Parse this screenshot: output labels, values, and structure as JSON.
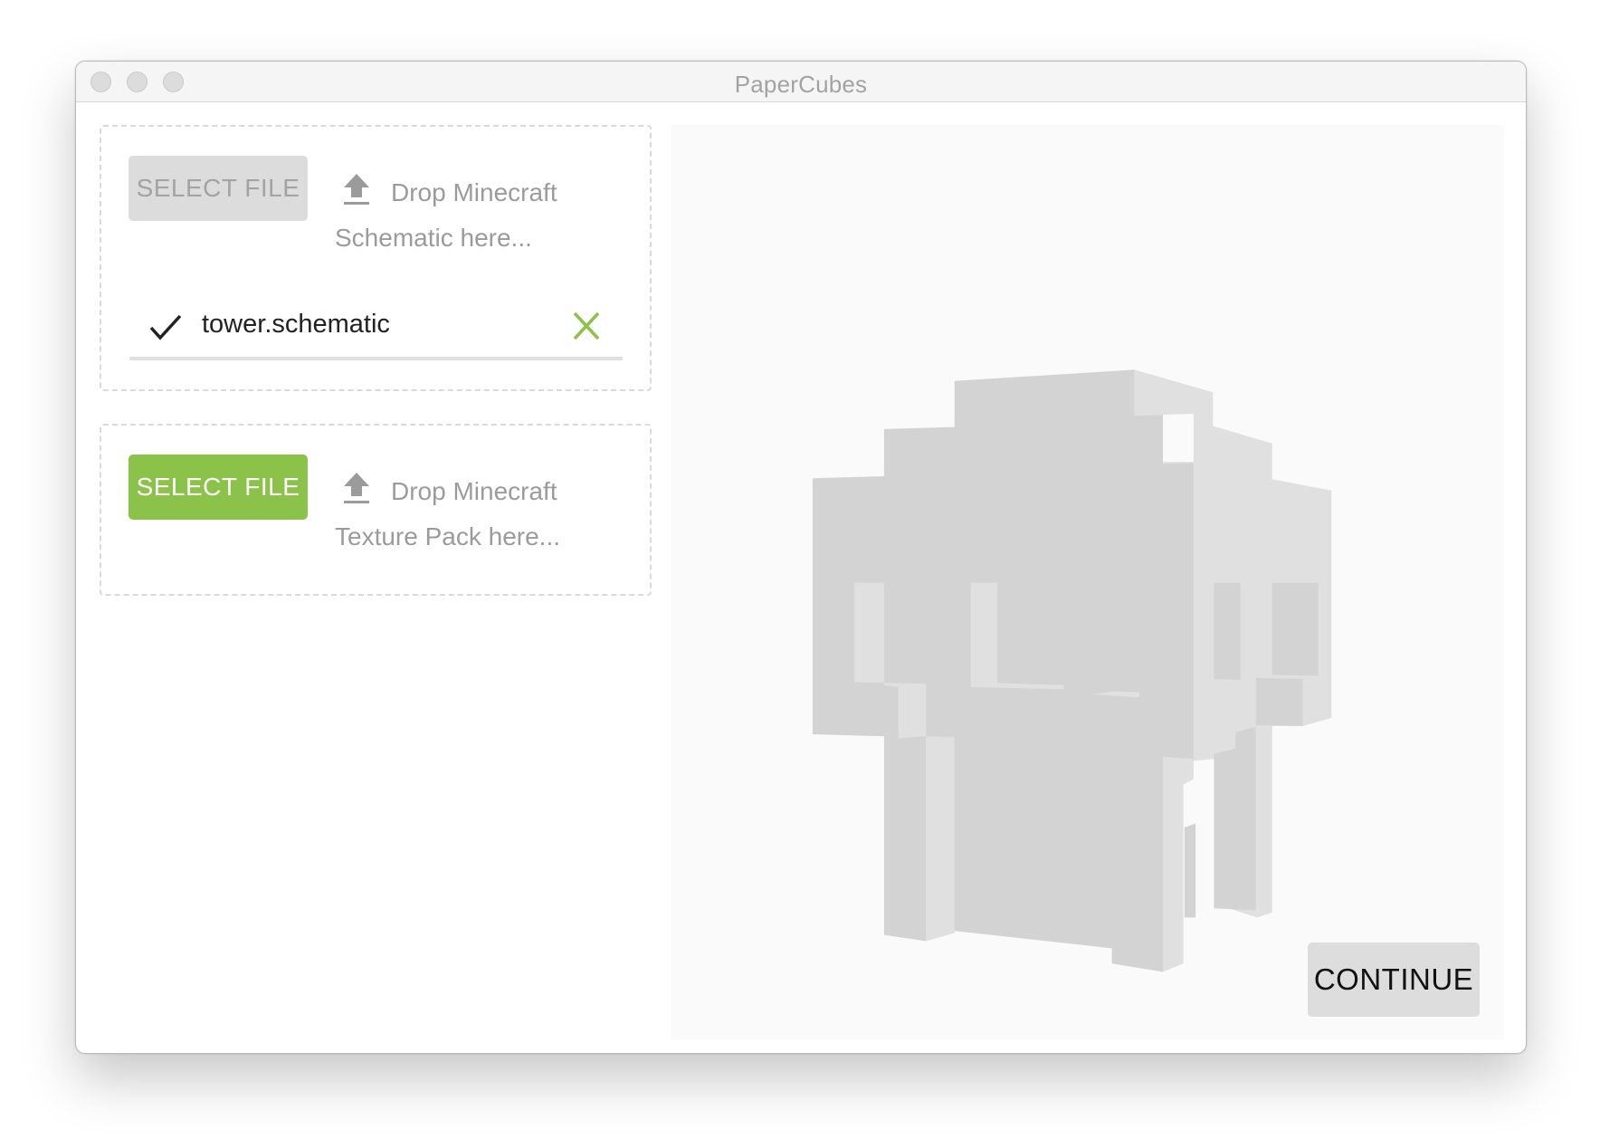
{
  "window": {
    "title": "PaperCubes",
    "controls": [
      "close",
      "minimize",
      "zoom"
    ]
  },
  "schematic_box": {
    "button_label": "SELECT FILE",
    "button_state": "disabled",
    "drop_line1": "Drop Minecraft",
    "drop_line2": "Schematic here...",
    "icon": "upload-icon",
    "loaded_file": {
      "status_icon": "check-icon",
      "name": "tower.schematic",
      "remove_icon": "close-icon"
    }
  },
  "texture_box": {
    "button_label": "SELECT FILE",
    "button_state": "enabled",
    "drop_line1": "Drop Minecraft",
    "drop_line2": "Texture Pack here...",
    "icon": "upload-icon"
  },
  "preview": {
    "description": "3D voxel model preview"
  },
  "continue_label": "CONTINUE",
  "colors": {
    "accent_green": "#8bc34a",
    "disabled_button": "#dcdcdc",
    "voxel_front": "#d3d3d3",
    "voxel_side": "#e0e0e0"
  }
}
